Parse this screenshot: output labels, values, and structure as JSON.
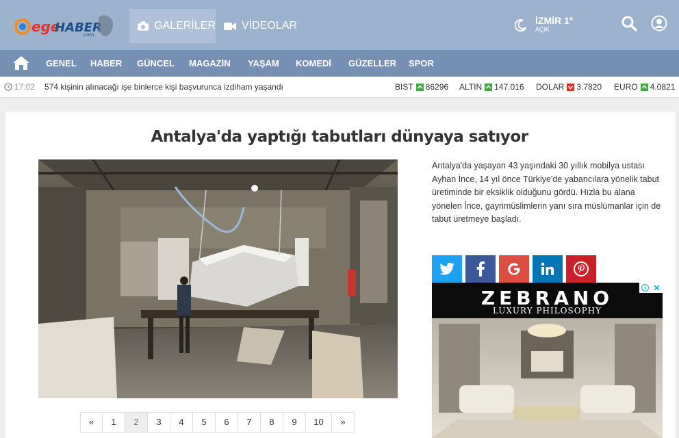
{
  "header": {
    "logo": {
      "ege": "ege",
      "haber": "HABER",
      "com": ".com"
    },
    "tabs": [
      {
        "label": "GALERİLER",
        "icon": "camera-icon"
      },
      {
        "label": "VİDEOLAR",
        "icon": "video-icon"
      }
    ],
    "weather": {
      "city": "İZMİR 1°",
      "condition": "AÇIK",
      "icon": "moon-weather-icon"
    }
  },
  "categories": [
    "GENEL",
    "HABER",
    "GÜNCEL",
    "MAGAZİN",
    "YAŞAM",
    "KOMEDİ",
    "GÜZELLER",
    "SPOR"
  ],
  "ticker": {
    "time": "17:02",
    "news": "574 kişinin alınacağı işe binlerce kişi başvurunca izdiham yaşandı",
    "markets": [
      {
        "name": "BIST",
        "direction": "up",
        "value": "86296"
      },
      {
        "name": "ALTIN",
        "direction": "up",
        "value": "147.016"
      },
      {
        "name": "DOLAR",
        "direction": "down",
        "value": "3.7820"
      },
      {
        "name": "EURO",
        "direction": "up",
        "value": "4.0821"
      }
    ],
    "colors": {
      "up": "#45a745",
      "down": "#d9352c"
    }
  },
  "article": {
    "title": "Antalya'da yaptığı tabutları dünyaya satıyor",
    "summary": "Antalya'da yaşayan 43 yaşındaki 30 yıllık mobilya ustası Ayhan İnce, 14 yıl önce Türkiye'de yabancılara yönelik tabut üretiminde bir eksiklik olduğunu gördü. Hızla bu alana yönelen İnce, gayrimüslimlerin yanı sıra müslümanlar için de tabut üretmeye başladı."
  },
  "pagination": {
    "prev": "«",
    "pages": [
      "1",
      "2",
      "3",
      "4",
      "5",
      "6",
      "7",
      "8",
      "9",
      "10"
    ],
    "current": "2",
    "next": "»"
  },
  "share": [
    "twitter-icon",
    "facebook-icon",
    "google-icon",
    "linkedin-icon",
    "pinterest-icon"
  ],
  "ad": {
    "brand": "ZEBRANO",
    "tagline": "LUXURY PHILOSOPHY"
  }
}
